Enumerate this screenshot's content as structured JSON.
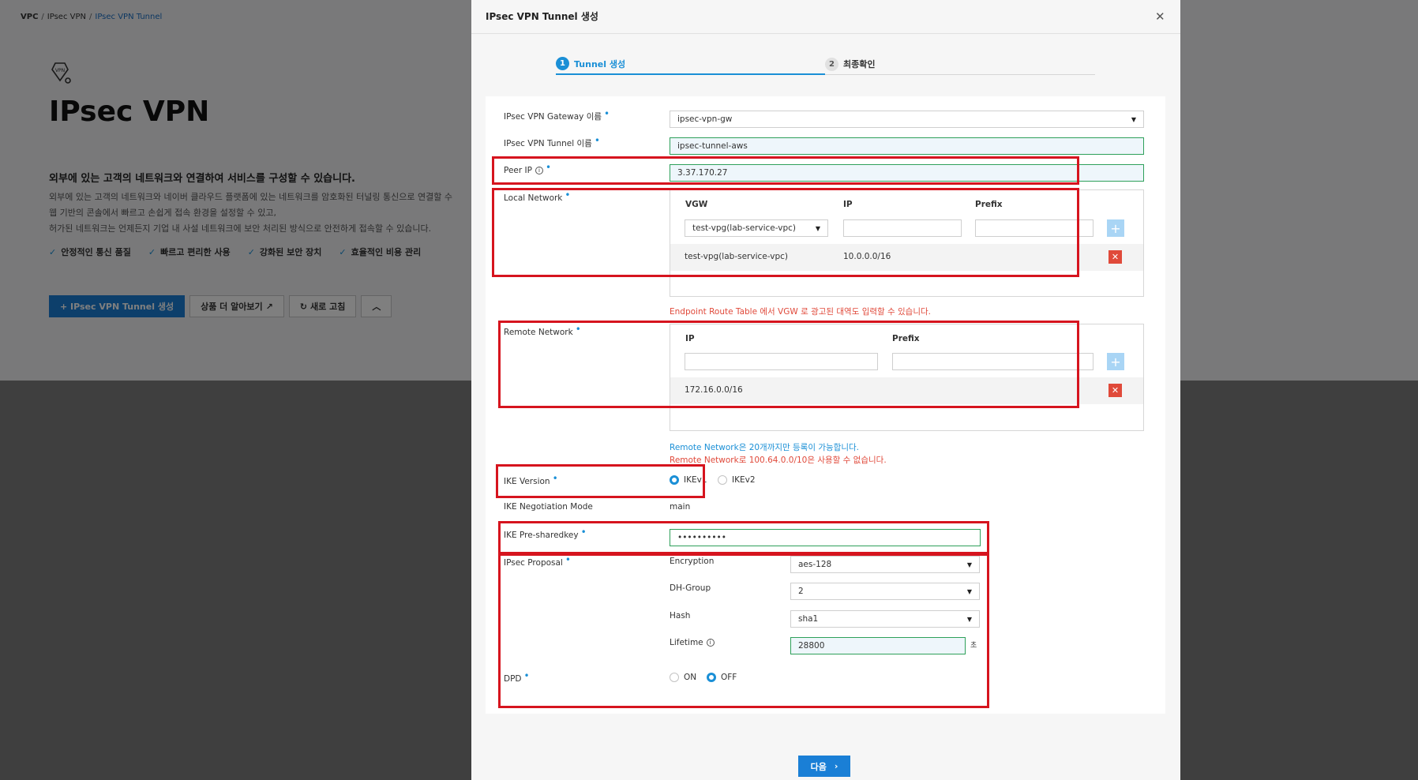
{
  "breadcrumb": [
    "VPC",
    "IPsec VPN",
    "IPsec VPN Tunnel"
  ],
  "page": {
    "title": "IPsec VPN",
    "subtitle": "외부에 있는 고객의 네트워크와 연결하여 서비스를 구성할 수 있습니다.",
    "description": [
      "외부에 있는 고객의 네트워크와 네이버 클라우드 플랫폼에 있는 네트워크를 암호화된 터널링 통신으로 연결할 수",
      "웹 기반의 콘솔에서 빠르고 손쉽게 접속 환경을 설정할 수 있고,",
      "허가된 네트워크는 언제든지 기업 내 사설 네트워크에 보안 처리된 방식으로 안전하게 접속할 수 있습니다."
    ],
    "features": [
      "안정적인 통신 품질",
      "빠르고 편리한 사용",
      "강화된 보안 장치",
      "효율적인 비용 관리"
    ],
    "buttons": {
      "create": "+ IPsec VPN Tunnel 생성",
      "learn_more": "상품 더 알아보기",
      "refresh": "새로 고침"
    }
  },
  "modal": {
    "title": "IPsec VPN Tunnel 생성",
    "steps": [
      {
        "num": "1",
        "label": "Tunnel 생성"
      },
      {
        "num": "2",
        "label": "최종확인"
      }
    ],
    "fields": {
      "gateway": {
        "label": "IPsec VPN Gateway 이름",
        "value": "ipsec-vpn-gw"
      },
      "tunnel": {
        "label": "IPsec VPN Tunnel 이름",
        "value": "ipsec-tunnel-aws"
      },
      "peer_ip": {
        "label": "Peer IP",
        "value": "3.37.170.27"
      },
      "local_network": {
        "label": "Local Network",
        "headers": [
          "VGW",
          "IP",
          "Prefix"
        ],
        "input_vgw": "test-vpg(lab-service-vpc)",
        "input_ip": "",
        "input_prefix": "",
        "rows": [
          {
            "vgw": "test-vpg(lab-service-vpc)",
            "ip": "10.0.0.0/16"
          }
        ],
        "hint": "Endpoint Route Table 에서 VGW 로 광고된 대역도 입력할 수 있습니다."
      },
      "remote_network": {
        "label": "Remote Network",
        "headers": [
          "IP",
          "Prefix"
        ],
        "input_ip": "",
        "input_prefix": "",
        "rows": [
          {
            "ip": "172.16.0.0/16"
          }
        ],
        "hint_blue": "Remote Network은 20개까지만 등록이 가능합니다.",
        "hint_red": "Remote Network로 100.64.0.0/10은 사용할 수 없습니다."
      },
      "ike_version": {
        "label": "IKE Version",
        "options": [
          "IKEv1",
          "IKEv2"
        ],
        "selected": "IKEv1"
      },
      "ike_mode": {
        "label": "IKE Negotiation Mode",
        "value": "main"
      },
      "ike_psk": {
        "label": "IKE Pre-sharedkey",
        "value": "••••••••••"
      },
      "ipsec_proposal": {
        "label": "IPsec Proposal",
        "encryption": {
          "label": "Encryption",
          "value": "aes-128"
        },
        "dh_group": {
          "label": "DH-Group",
          "value": "2"
        },
        "hash": {
          "label": "Hash",
          "value": "sha1"
        },
        "lifetime": {
          "label": "Lifetime",
          "value": "28800",
          "unit": "초"
        }
      },
      "dpd": {
        "label": "DPD",
        "options": [
          "ON",
          "OFF"
        ],
        "selected": "OFF"
      }
    },
    "next_button": "다음"
  },
  "colors": {
    "accent": "#1a8fd6",
    "highlight": "#d6141e",
    "danger": "#e04a3a",
    "primary_button": "#1a7fd6"
  }
}
